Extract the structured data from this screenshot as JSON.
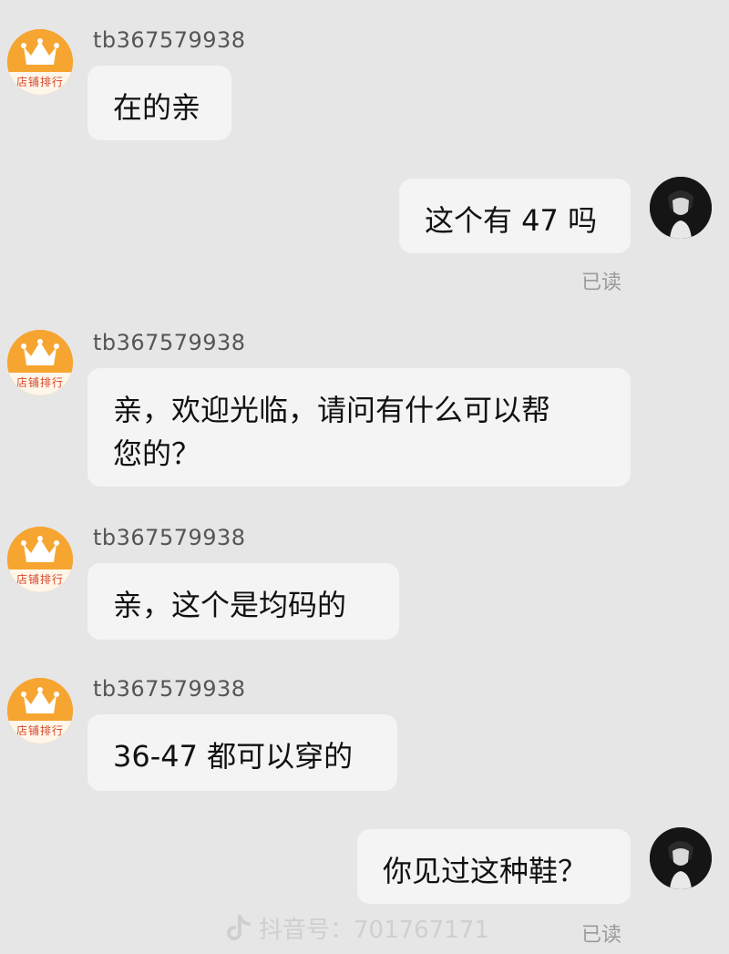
{
  "messages": [
    {
      "sender": "shop",
      "username": "tb367579938",
      "text": "在的亲"
    },
    {
      "sender": "user",
      "text": "这个有 47 吗",
      "status": "已读"
    },
    {
      "sender": "shop",
      "username": "tb367579938",
      "text": "亲，欢迎光临，请问有什么可以帮\n您的？"
    },
    {
      "sender": "shop",
      "username": "tb367579938",
      "text": "亲，这个是均码的"
    },
    {
      "sender": "shop",
      "username": "tb367579938",
      "text": "36-47 都可以穿的"
    },
    {
      "sender": "user",
      "text": "你见过这种鞋？",
      "status": "已读"
    }
  ],
  "shop_avatar_label": "店铺排行",
  "watermark": {
    "icon": "tiktok-icon",
    "text": "抖音号：701767171"
  },
  "colors": {
    "background": "#e6e6e6",
    "bubble": "#f4f4f4",
    "avatar_orange": "#f39b2a"
  }
}
